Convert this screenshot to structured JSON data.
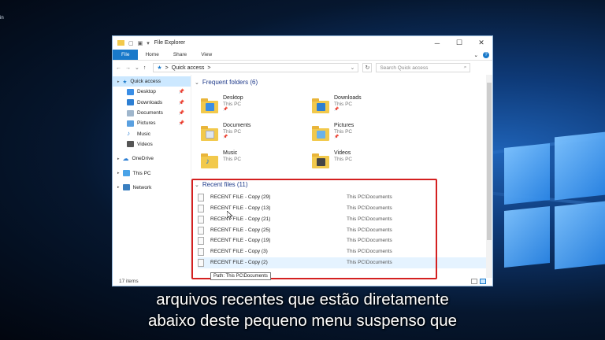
{
  "desktop": {
    "edge_text": "in"
  },
  "window": {
    "title": "File Explorer",
    "controls": {
      "minimize": "─",
      "maximize": "☐",
      "close": "✕"
    }
  },
  "ribbon": {
    "tabs": [
      "File",
      "Home",
      "Share",
      "View"
    ],
    "expand": "⌄",
    "help": "?"
  },
  "navbar": {
    "back": "←",
    "forward": "→",
    "recent": "⌄",
    "up": "↑",
    "breadcrumb": "Quick access",
    "sep": ">",
    "dropdown": "⌄",
    "refresh": "↻",
    "search_placeholder": "Search Quick access",
    "search_icon": "⌕"
  },
  "sidebar": {
    "quick_access": "Quick access",
    "pinned": [
      {
        "label": "Desktop",
        "color": "#3a8ee6"
      },
      {
        "label": "Downloads",
        "color": "#2d7fd3"
      },
      {
        "label": "Documents",
        "color": "#9fb6cc"
      },
      {
        "label": "Pictures",
        "color": "#5aa0e0"
      },
      {
        "label": "Music",
        "color": "#2d7fd3"
      },
      {
        "label": "Videos",
        "color": "#555555"
      }
    ],
    "onedrive": "OneDrive",
    "this_pc": "This PC",
    "network": "Network",
    "pin_glyph": "📌"
  },
  "frequent": {
    "header": "Frequent folders (6)",
    "items": [
      {
        "name": "Desktop",
        "location": "This PC",
        "badge": "#3a8ee6"
      },
      {
        "name": "Downloads",
        "location": "This PC",
        "badge": "#2d7fd3"
      },
      {
        "name": "Documents",
        "location": "This PC",
        "badge": "#dfe7ef"
      },
      {
        "name": "Pictures",
        "location": "This PC",
        "badge": "#6bb2ea"
      },
      {
        "name": "Music",
        "location": "This PC",
        "badge": "#2d7fd3"
      },
      {
        "name": "Videos",
        "location": "This PC",
        "badge": "#444444"
      }
    ]
  },
  "recent": {
    "header": "Recent files (11)",
    "items": [
      {
        "name": "RECENT FILE - Copy (29)",
        "path": "This PC\\Documents"
      },
      {
        "name": "RECENT FILE - Copy (13)",
        "path": "This PC\\Documents"
      },
      {
        "name": "RECENT FILE - Copy (21)",
        "path": "This PC\\Documents"
      },
      {
        "name": "RECENT FILE - Copy (25)",
        "path": "This PC\\Documents"
      },
      {
        "name": "RECENT FILE - Copy (19)",
        "path": "This PC\\Documents"
      },
      {
        "name": "RECENT FILE - Copy (3)",
        "path": "This PC\\Documents"
      },
      {
        "name": "RECENT FILE - Copy (2)",
        "path": "This PC\\Documents"
      }
    ],
    "tooltip": "Path: This PC\\Documents"
  },
  "status": {
    "count": "17 items"
  },
  "subtitle": {
    "line1": "arquivos recentes que estão diretamente",
    "line2": "abaixo deste pequeno menu suspenso que"
  },
  "colors": {
    "accent": "#1979ca",
    "highlight": "#d42020",
    "selection": "#cce8ff"
  }
}
